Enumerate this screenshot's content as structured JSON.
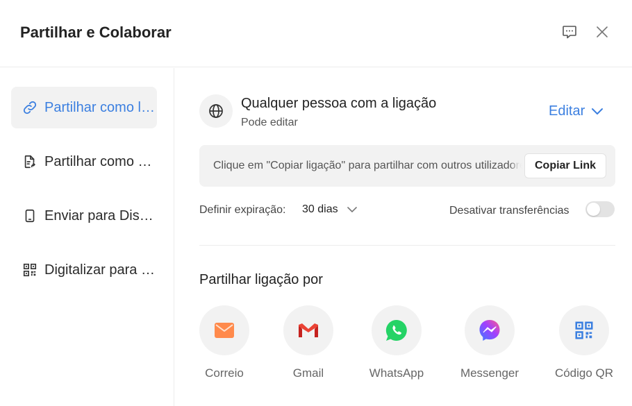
{
  "dialog": {
    "title": "Partilhar e Colaborar"
  },
  "sidebar": {
    "items": [
      {
        "label": "Partilhar como link",
        "icon": "link-icon",
        "active": true
      },
      {
        "label": "Partilhar como ficheiro",
        "icon": "file-share-icon",
        "active": false
      },
      {
        "label": "Enviar para Dispositivo",
        "icon": "phone-icon",
        "active": false
      },
      {
        "label": "Digitalizar para partilhar",
        "icon": "qr-code-icon",
        "active": false
      }
    ]
  },
  "access": {
    "icon": "globe-icon",
    "title": "Qualquer pessoa com a ligação",
    "subtitle": "Pode editar",
    "edit_label": "Editar"
  },
  "link": {
    "hint": "Clique em \"Copiar ligação\" para partilhar com outros utilizadores",
    "copy_label": "Copiar Link"
  },
  "options": {
    "expiry_label": "Definir expiração:",
    "expiry_value": "30 dias",
    "disable_downloads_label": "Desativar transferências",
    "disable_downloads_on": false
  },
  "share_via": {
    "heading": "Partilhar ligação por",
    "targets": [
      {
        "label": "Correio",
        "icon": "mail-icon",
        "color": "#ff8a4c"
      },
      {
        "label": "Gmail",
        "icon": "gmail-icon",
        "color": "#ea4335"
      },
      {
        "label": "WhatsApp",
        "icon": "whatsapp-icon",
        "color": "#25d366"
      },
      {
        "label": "Messenger",
        "icon": "messenger-icon",
        "color": "#8e4dff"
      },
      {
        "label": "Código QR",
        "icon": "qr-code-icon",
        "color": "#3b7fe0"
      }
    ]
  },
  "colors": {
    "accent": "#3b7fe0",
    "panel_bg": "#f2f2f2"
  }
}
